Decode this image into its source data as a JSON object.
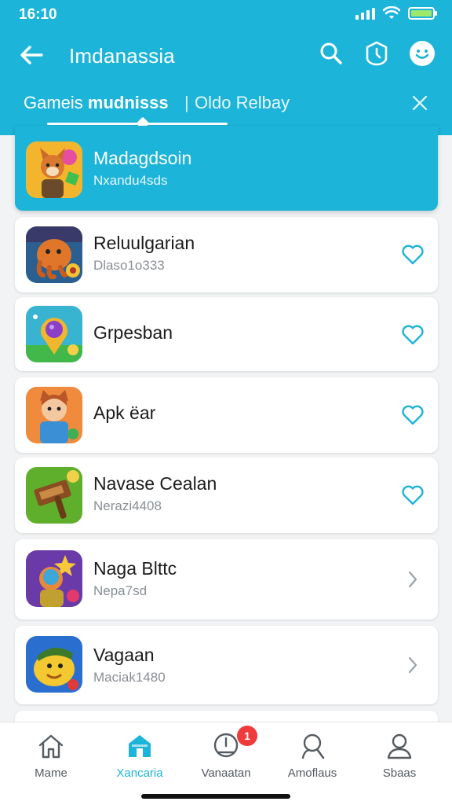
{
  "status": {
    "time": "16:10"
  },
  "nav": {
    "title": "Imdanassia",
    "icons": [
      "back-arrow-icon",
      "search-icon",
      "timer-shield-icon",
      "face-icon"
    ]
  },
  "tabs": {
    "tab1_prefix": "Gameis",
    "tab1_strong": "mudnisss",
    "separator": "|",
    "tab2": "Oldo Relbay"
  },
  "items": [
    {
      "name": "Madagdsoin",
      "sub": "Nxandu4sds",
      "action": "none",
      "selected": true,
      "thumb": "fox-game-thumb"
    },
    {
      "name": "Reluulgarian",
      "sub": "Dlaso1o333",
      "action": "heart-icon",
      "selected": false,
      "thumb": "octopus-game-thumb"
    },
    {
      "name": "Grpesban",
      "sub": "",
      "action": "heart-icon",
      "selected": false,
      "thumb": "gem-map-thumb"
    },
    {
      "name": "Apk ëar",
      "sub": "",
      "action": "heart-icon",
      "selected": false,
      "thumb": "boy-character-thumb"
    },
    {
      "name": "Navase Cealan",
      "sub": "Nerazi4408",
      "action": "heart-icon",
      "selected": false,
      "thumb": "hammer-game-thumb"
    },
    {
      "name": "Naga Blttc",
      "sub": "Nepa7sd",
      "action": "chevron-right-icon",
      "selected": false,
      "thumb": "hero-character-thumb"
    },
    {
      "name": "Vagaan",
      "sub": "Maciak1480",
      "action": "chevron-right-icon",
      "selected": false,
      "thumb": "yellow-bird-thumb"
    }
  ],
  "bottom_nav": [
    {
      "label": "Mame",
      "icon": "home-icon",
      "active": false
    },
    {
      "label": "Xancaria",
      "icon": "store-icon",
      "active": true
    },
    {
      "label": "Vanaatan",
      "icon": "clock-icon",
      "active": false,
      "badge": "1"
    },
    {
      "label": "Amoflaus",
      "icon": "search-person-icon",
      "active": false
    },
    {
      "label": "Sbaas",
      "icon": "profile-icon",
      "active": false
    }
  ],
  "colors": {
    "accent": "#1cb4d8",
    "badge": "#ef3b3b",
    "background": "#f1f3f5"
  }
}
